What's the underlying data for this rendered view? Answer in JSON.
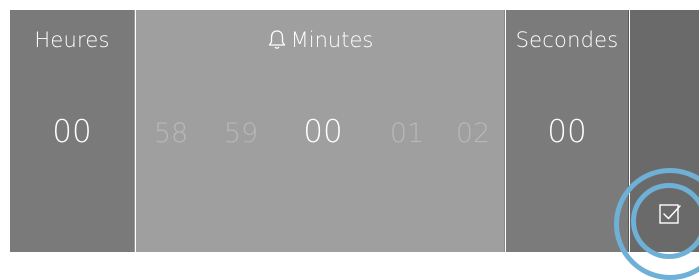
{
  "hours": {
    "title": "Heures",
    "value": "00"
  },
  "minutes": {
    "title": "Minutes",
    "icon": "bell-icon",
    "items": [
      "58",
      "59",
      "00",
      "01",
      "02"
    ],
    "selected": "00"
  },
  "seconds": {
    "title": "Secondes",
    "value": "00"
  },
  "confirm": {
    "icon": "checkbox-check-icon"
  },
  "colors": {
    "hours_bg": "#7a7a7a",
    "minutes_bg": "#9f9f9f",
    "seconds_bg": "#7b7b7b",
    "confirm_bg": "#6a6a6a",
    "focus_ring": "#6fb0d6"
  }
}
